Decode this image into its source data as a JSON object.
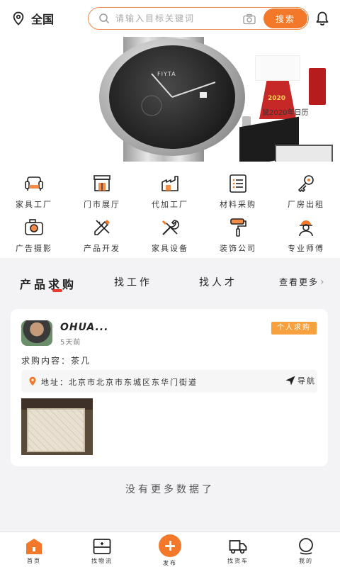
{
  "header": {
    "location_label": "全国",
    "search_placeholder": "请输入目标关键词",
    "search_button": "搜索"
  },
  "banner": {
    "watch_brand": "FIYTA",
    "calendar_year": "2020",
    "calendar_caption": "鼠2020年日历"
  },
  "categories": [
    {
      "label": "家具工厂",
      "icon": "sofa-icon"
    },
    {
      "label": "门市展厅",
      "icon": "storefront-icon"
    },
    {
      "label": "代加工厂",
      "icon": "factory-icon"
    },
    {
      "label": "材料采购",
      "icon": "list-icon"
    },
    {
      "label": "厂房出租",
      "icon": "key-icon"
    },
    {
      "label": "广告摄影",
      "icon": "camera-icon"
    },
    {
      "label": "产品开发",
      "icon": "pencil-ruler-icon"
    },
    {
      "label": "家具设备",
      "icon": "tools-icon"
    },
    {
      "label": "装饰公司",
      "icon": "paint-roller-icon"
    },
    {
      "label": "专业师傅",
      "icon": "worker-icon"
    }
  ],
  "tabs": {
    "items": [
      "产品求购",
      "找工作",
      "找人才"
    ],
    "more": "查看更多"
  },
  "post": {
    "username": "OHUA...",
    "time": "5天前",
    "badge": "个人求购",
    "content": "求购内容：茶几",
    "address": "地址：北京市北京市东城区东华门街道",
    "nav_label": "导航"
  },
  "footer_text": "没有更多数据了",
  "bottom_nav": [
    {
      "label": "首页",
      "icon": "home-icon"
    },
    {
      "label": "找物流",
      "icon": "logistics-icon"
    },
    {
      "label": "发布",
      "icon": "plus-icon"
    },
    {
      "label": "找货车",
      "icon": "truck-icon"
    },
    {
      "label": "我的",
      "icon": "profile-icon"
    }
  ],
  "colors": {
    "accent": "#f4782a",
    "badge": "#f7a13e",
    "tab_underline": "#e83a2f"
  }
}
